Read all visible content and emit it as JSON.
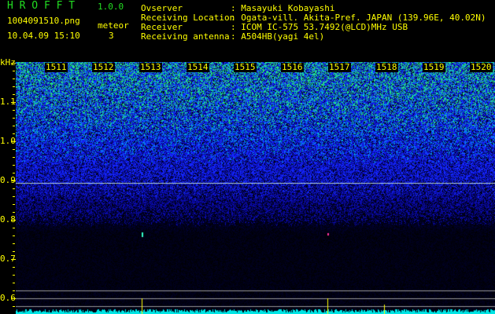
{
  "app": {
    "logo": "H R O F F T",
    "version": "1.0.0"
  },
  "file": {
    "name": "1004091510.png",
    "datetime": "10.04.09 15:10"
  },
  "meteor": {
    "label": "meteor",
    "count": "3"
  },
  "info": [
    {
      "label": "Ovserver",
      "value": ": Masayuki Kobayashi"
    },
    {
      "label": "Receiving Location",
      "value": ": Ogata-vill. Akita-Pref. JAPAN (139.96E, 40.02N)"
    },
    {
      "label": "Receiver",
      "value": ": ICOM IC-575 53.7492(@LCD)MHz USB"
    },
    {
      "label": "Receiving antenna",
      "value": ": A504HB(yagi 4el)"
    }
  ],
  "spectrogram": {
    "y_unit": "kHz",
    "y_ticks": [
      "1.1",
      "1.0",
      "0.9",
      "0.8",
      "0.7",
      "0.6"
    ],
    "time_labels": [
      "1511",
      "1512",
      "1513",
      "1514",
      "1515",
      "1516",
      "1517",
      "1518",
      "1519",
      "1520"
    ],
    "colors": {
      "text": "#ffff00",
      "logo": "#22dd22",
      "noise_floor": "#00e5e5",
      "marker": "#ffff00"
    }
  }
}
